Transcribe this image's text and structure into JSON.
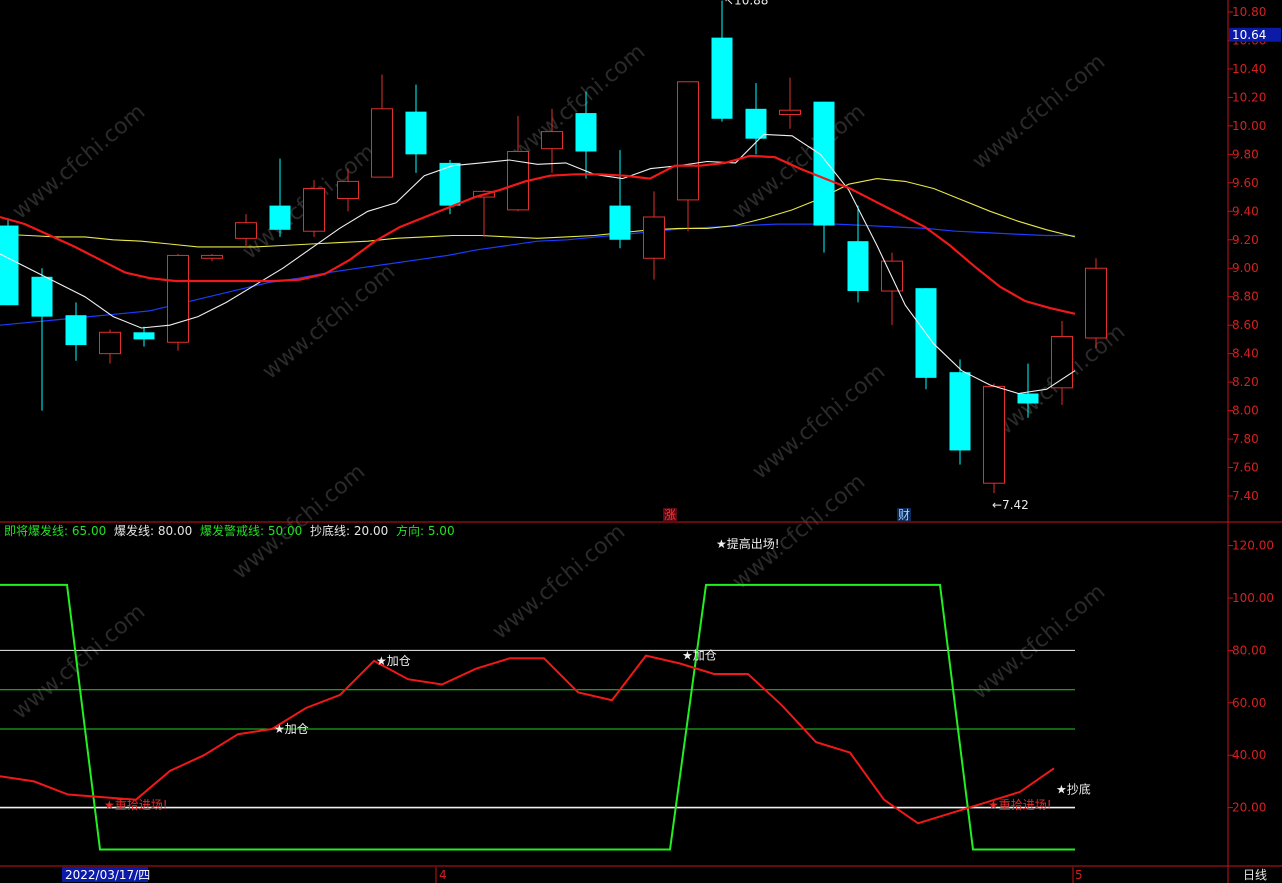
{
  "chart_data": [
    {
      "type": "candlestick",
      "price_label": "10.64",
      "ylim": [
        7.3,
        10.9
      ],
      "yticks": [
        "10.80",
        "10.60",
        "10.40",
        "10.20",
        "10.00",
        "9.80",
        "9.60",
        "9.40",
        "9.20",
        "9.00",
        "8.80",
        "8.60",
        "8.40",
        "8.20",
        "8.00",
        "7.80",
        "7.60",
        "7.40"
      ],
      "candles": [
        {
          "o": 9.3,
          "h": 9.35,
          "l": 8.74,
          "c": 8.74
        },
        {
          "o": 8.94,
          "h": 9.0,
          "l": 8.0,
          "c": 8.66
        },
        {
          "o": 8.67,
          "h": 8.76,
          "l": 8.35,
          "c": 8.46
        },
        {
          "o": 8.4,
          "h": 8.57,
          "l": 8.33,
          "c": 8.55
        },
        {
          "o": 8.55,
          "h": 8.59,
          "l": 8.45,
          "c": 8.5
        },
        {
          "o": 8.48,
          "h": 9.1,
          "l": 8.42,
          "c": 9.09
        },
        {
          "o": 9.07,
          "h": 9.1,
          "l": 9.05,
          "c": 9.09
        },
        {
          "o": 9.21,
          "h": 9.38,
          "l": 9.14,
          "c": 9.32
        },
        {
          "o": 9.44,
          "h": 9.77,
          "l": 9.22,
          "c": 9.27
        },
        {
          "o": 9.26,
          "h": 9.62,
          "l": 9.22,
          "c": 9.56
        },
        {
          "o": 9.49,
          "h": 9.7,
          "l": 9.4,
          "c": 9.61
        },
        {
          "o": 9.64,
          "h": 10.36,
          "l": 9.64,
          "c": 10.12
        },
        {
          "o": 10.1,
          "h": 10.29,
          "l": 9.67,
          "c": 9.8
        },
        {
          "o": 9.74,
          "h": 9.76,
          "l": 9.38,
          "c": 9.44
        },
        {
          "o": 9.5,
          "h": 9.55,
          "l": 9.22,
          "c": 9.54
        },
        {
          "o": 9.41,
          "h": 10.07,
          "l": 9.4,
          "c": 9.82
        },
        {
          "o": 9.84,
          "h": 10.12,
          "l": 9.67,
          "c": 9.96
        },
        {
          "o": 10.09,
          "h": 10.24,
          "l": 9.63,
          "c": 9.82
        },
        {
          "o": 9.44,
          "h": 9.83,
          "l": 9.14,
          "c": 9.2
        },
        {
          "o": 9.07,
          "h": 9.54,
          "l": 8.92,
          "c": 9.36
        },
        {
          "o": 9.48,
          "h": 10.31,
          "l": 9.26,
          "c": 10.31
        },
        {
          "o": 10.62,
          "h": 10.88,
          "l": 10.03,
          "c": 10.05
        },
        {
          "o": 10.12,
          "h": 10.3,
          "l": 9.8,
          "c": 9.91
        },
        {
          "o": 10.08,
          "h": 10.34,
          "l": 9.98,
          "c": 10.11
        },
        {
          "o": 10.17,
          "h": 10.17,
          "l": 9.11,
          "c": 9.3
        },
        {
          "o": 9.19,
          "h": 9.44,
          "l": 8.76,
          "c": 8.84
        },
        {
          "o": 8.84,
          "h": 9.11,
          "l": 8.6,
          "c": 9.05
        },
        {
          "o": 8.86,
          "h": 8.86,
          "l": 8.15,
          "c": 8.23
        },
        {
          "o": 8.27,
          "h": 8.36,
          "l": 7.62,
          "c": 7.72
        },
        {
          "o": 7.49,
          "h": 8.19,
          "l": 7.42,
          "c": 8.17
        },
        {
          "o": 8.12,
          "h": 8.33,
          "l": 7.95,
          "c": 8.05
        },
        {
          "o": 8.16,
          "h": 8.63,
          "l": 8.04,
          "c": 8.52
        },
        {
          "o": 8.51,
          "h": 9.07,
          "l": 8.44,
          "c": 9.0
        }
      ],
      "ma_white": [
        9.1,
        9.0,
        8.9,
        8.8,
        8.66,
        8.58,
        8.6,
        8.66,
        8.76,
        8.88,
        9.0,
        9.14,
        9.28,
        9.4,
        9.46,
        9.65,
        9.72,
        9.74,
        9.76,
        9.73,
        9.74,
        9.66,
        9.63,
        9.7,
        9.72,
        9.75,
        9.74,
        9.94,
        9.93,
        9.8,
        9.55,
        9.16,
        8.74,
        8.47,
        8.28,
        8.18,
        8.12,
        8.15,
        8.28
      ],
      "ma_red": [
        9.36,
        9.31,
        9.23,
        9.15,
        9.06,
        8.97,
        8.93,
        8.91,
        8.91,
        8.91,
        8.91,
        8.91,
        8.92,
        8.96,
        9.06,
        9.19,
        9.29,
        9.36,
        9.43,
        9.5,
        9.55,
        9.61,
        9.65,
        9.66,
        9.66,
        9.65,
        9.63,
        9.72,
        9.72,
        9.74,
        9.79,
        9.78,
        9.7,
        9.63,
        9.56,
        9.47,
        9.38,
        9.29,
        9.16,
        9.01,
        8.87,
        8.77,
        8.72,
        8.68
      ],
      "ma_yellow": [
        9.24,
        9.23,
        9.22,
        9.22,
        9.2,
        9.19,
        9.17,
        9.15,
        9.15,
        9.15,
        9.16,
        9.17,
        9.18,
        9.19,
        9.21,
        9.22,
        9.23,
        9.23,
        9.22,
        9.21,
        9.22,
        9.23,
        9.25,
        9.27,
        9.28,
        9.28,
        9.3,
        9.35,
        9.41,
        9.49,
        9.59,
        9.63,
        9.61,
        9.56,
        9.48,
        9.4,
        9.33,
        9.27,
        9.22
      ],
      "ma_blue": [
        8.6,
        8.62,
        8.64,
        8.66,
        8.68,
        8.7,
        8.75,
        8.8,
        8.85,
        8.9,
        8.93,
        8.97,
        9.0,
        9.03,
        9.06,
        9.09,
        9.13,
        9.16,
        9.19,
        9.2,
        9.22,
        9.24,
        9.26,
        9.28,
        9.29,
        9.3,
        9.31,
        9.31,
        9.31,
        9.3,
        9.29,
        9.28,
        9.26,
        9.25,
        9.24,
        9.23,
        9.23
      ],
      "annotations": {
        "high": "10.88",
        "low": "7.42"
      },
      "markers": [
        "涨",
        "财"
      ]
    },
    {
      "type": "line",
      "legend": [
        {
          "name": "即将爆发线",
          "value": "65.00",
          "color": "#22e022"
        },
        {
          "name": "爆发线",
          "value": "80.00",
          "color": "#e6e6e6"
        },
        {
          "name": "爆发警戒线",
          "value": "50.00",
          "color": "#22e022"
        },
        {
          "name": "抄底线",
          "value": "20.00",
          "color": "#e6e6e6"
        },
        {
          "name": "方向",
          "value": "5.00",
          "color": "#22e022"
        }
      ],
      "ylim": [
        0,
        130
      ],
      "yticks": [
        "120.00",
        "100.00",
        "80.00",
        "60.00",
        "40.00",
        "20.00"
      ],
      "hlines": [
        80,
        65,
        50,
        20
      ],
      "green_series": [
        105,
        105,
        4,
        4,
        4,
        4,
        4,
        4,
        4,
        4,
        4,
        4,
        4,
        4,
        4,
        4,
        4,
        4,
        4,
        4,
        4,
        105,
        105,
        105,
        105,
        105,
        105,
        105,
        105,
        4,
        4,
        4,
        4
      ],
      "red_series": [
        32,
        30,
        25,
        24,
        23,
        34,
        40,
        48,
        50,
        58,
        63,
        76,
        69,
        67,
        73,
        77,
        77,
        64,
        61,
        78,
        75,
        71,
        71,
        59,
        45,
        41,
        23,
        14,
        18,
        22,
        26,
        35
      ],
      "signals": [
        {
          "text": "★提高出场!",
          "idx": 21,
          "y": 131
        },
        {
          "text": "★加仓",
          "idx": 11,
          "y": 76
        },
        {
          "text": "★加仓",
          "idx": 20,
          "y": 78
        },
        {
          "text": "★加仓",
          "idx": 8,
          "y": 50
        },
        {
          "text": "★重拾进场!",
          "idx": 3,
          "y": 21
        },
        {
          "text": "★重拾进场!",
          "idx": 29,
          "y": 21
        },
        {
          "text": "★抄底",
          "idx": 31,
          "y": 27
        }
      ],
      "dates": [
        "2022/03/17/四",
        "4",
        "5"
      ],
      "period": "日线"
    }
  ],
  "watermark": "www.cfchi.com",
  "colors": {
    "up": "#e0302c",
    "down": "#00ffff",
    "bg": "#000000",
    "axis": "#d42020",
    "price_box": "#0c1aa8"
  }
}
